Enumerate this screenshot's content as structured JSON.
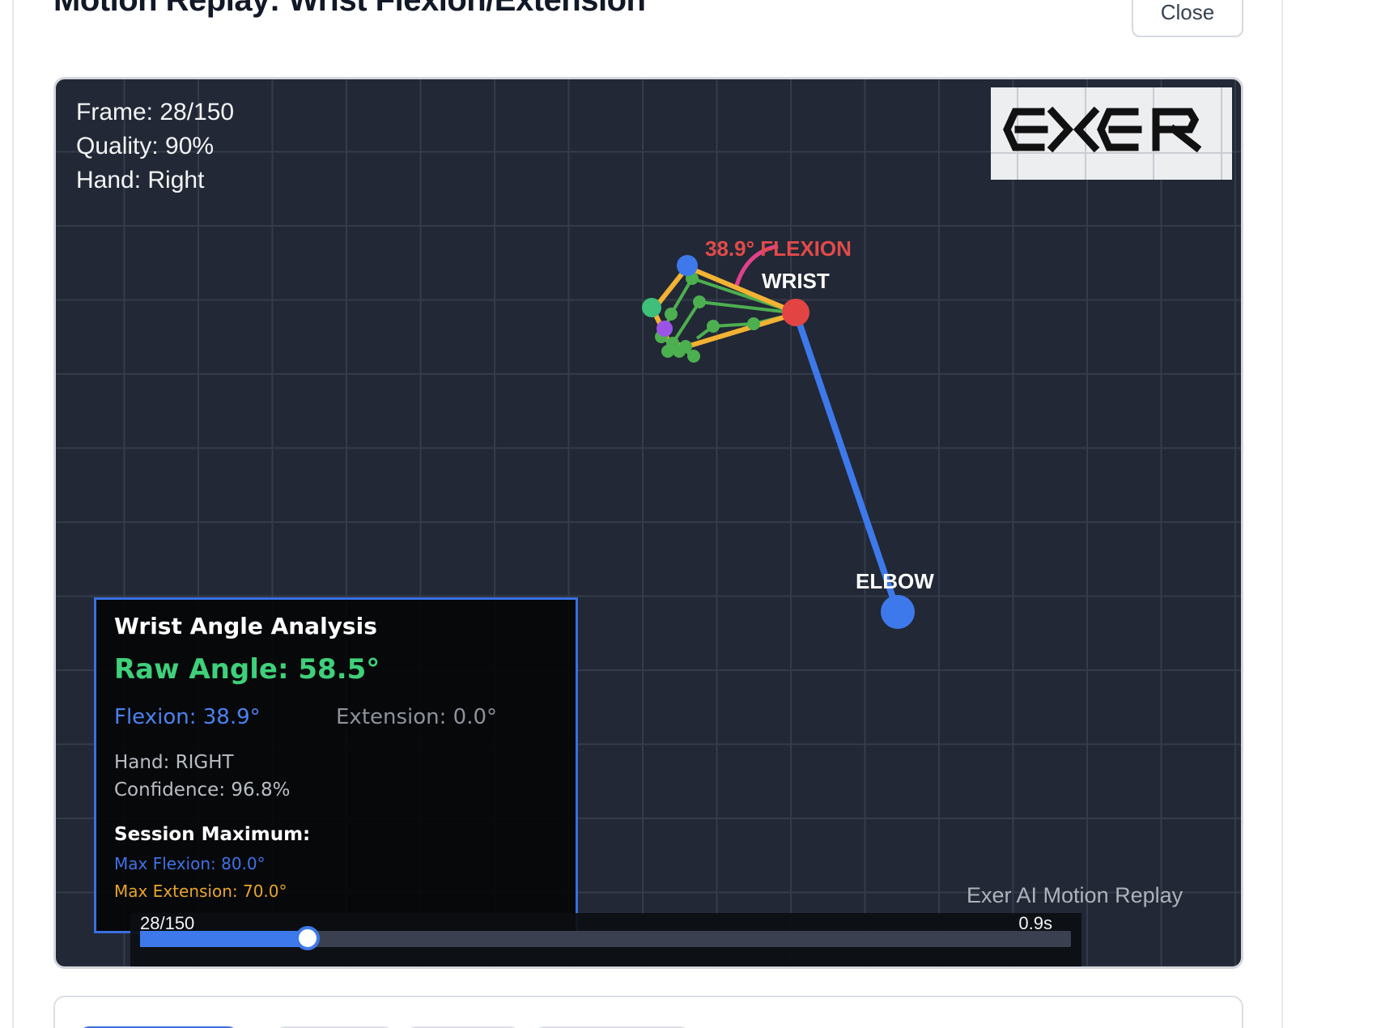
{
  "modal": {
    "title": "Motion Replay: Wrist Flexion/Extension",
    "close_label": "Close"
  },
  "hud": {
    "frame": "Frame: 28/150",
    "quality": "Quality: 90%",
    "hand": "Hand: Right"
  },
  "logo": {
    "text": "EXER"
  },
  "skeleton": {
    "flexion_label": "38.9° FLEXION",
    "wrist_label": "WRIST",
    "elbow_label": "ELBOW",
    "colors": {
      "forearm": "#3d79ea",
      "wrist_joint": "#e24444",
      "elbow_joint": "#3d79ea",
      "hand_outline": "#f2b233",
      "fingers": "#4caf50",
      "angle_arc": "#e0418b",
      "flexion_text": "#e24a4a"
    }
  },
  "analysis": {
    "title": "Wrist Angle Analysis",
    "raw_angle": "Raw Angle: 58.5°",
    "flexion": "Flexion: 38.9°",
    "extension": "Extension: 0.0°",
    "hand": "Hand: RIGHT",
    "confidence": "Confidence: 96.8%",
    "session_title": "Session Maximum:",
    "max_flexion": "Max Flexion: 80.0°",
    "max_extension": "Max Extension: 70.0°"
  },
  "watermark": "Exer AI Motion Replay",
  "timeline": {
    "frame_label": "28/150",
    "time_label": "0.9s",
    "progress": 0.18
  }
}
